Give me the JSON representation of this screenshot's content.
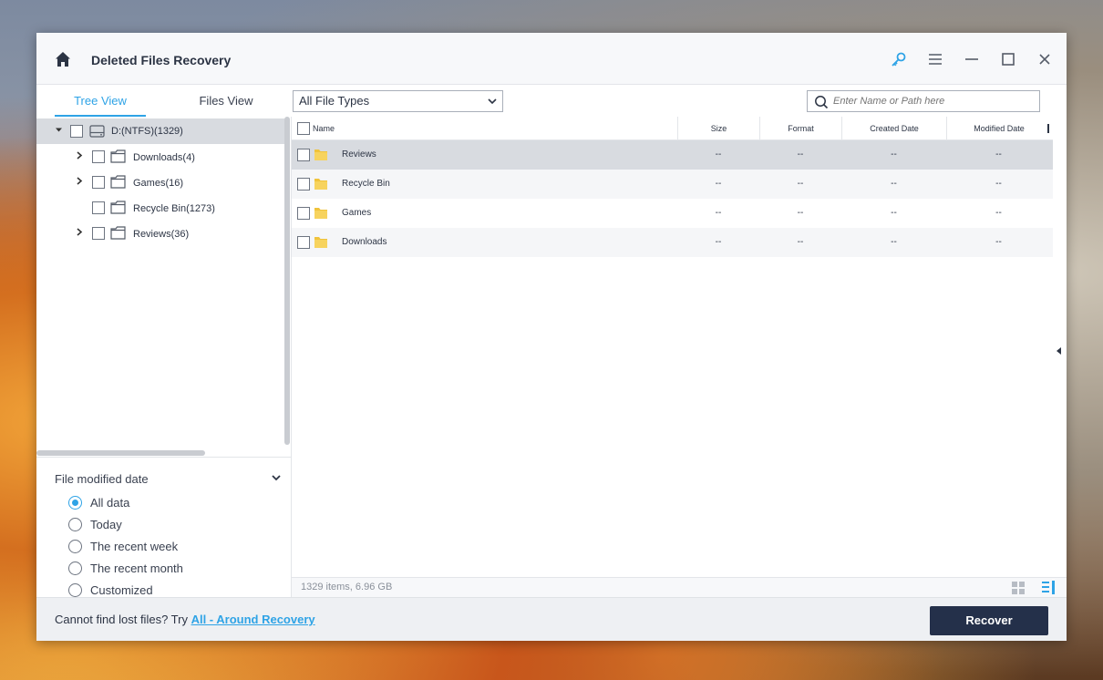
{
  "window": {
    "title": "Deleted Files Recovery",
    "icons": {
      "home": "home-icon",
      "key": "key-icon",
      "menu": "menu-icon",
      "minimize": "minimize-icon",
      "maximize": "maximize-icon",
      "close": "close-icon"
    },
    "accent_color": "#2ea3e6"
  },
  "tabs": [
    {
      "label": "Tree View",
      "active": true
    },
    {
      "label": "Files View",
      "active": false
    }
  ],
  "filter": {
    "file_type_selected": "All File Types",
    "search_placeholder": "Enter Name or Path here"
  },
  "tree": {
    "root": {
      "label": "D:(NTFS)(1329)",
      "expanded": true,
      "icon": "drive-icon"
    },
    "children": [
      {
        "label": "Downloads(4)",
        "has_children": true
      },
      {
        "label": "Games(16)",
        "has_children": true
      },
      {
        "label": "Recycle Bin(1273)",
        "has_children": false
      },
      {
        "label": "Reviews(36)",
        "has_children": true
      }
    ]
  },
  "date_filter": {
    "title": "File modified date",
    "options": [
      {
        "label": "All data",
        "selected": true
      },
      {
        "label": "Today",
        "selected": false
      },
      {
        "label": "The recent week",
        "selected": false
      },
      {
        "label": "The recent month",
        "selected": false
      },
      {
        "label": "Customized",
        "selected": false
      }
    ]
  },
  "table": {
    "columns": {
      "name": "Name",
      "size": "Size",
      "format": "Format",
      "created": "Created Date",
      "modified": "Modified Date"
    },
    "rows": [
      {
        "name": "Reviews",
        "size": "--",
        "format": "--",
        "created": "--",
        "modified": "--"
      },
      {
        "name": "Recycle Bin",
        "size": "--",
        "format": "--",
        "created": "--",
        "modified": "--"
      },
      {
        "name": "Games",
        "size": "--",
        "format": "--",
        "created": "--",
        "modified": "--"
      },
      {
        "name": "Downloads",
        "size": "--",
        "format": "--",
        "created": "--",
        "modified": "--"
      }
    ]
  },
  "status": {
    "summary": "1329 items, 6.96 GB"
  },
  "footer": {
    "prompt": "Cannot find lost files? Try ",
    "link": "All - Around Recovery",
    "recover_label": "Recover"
  }
}
